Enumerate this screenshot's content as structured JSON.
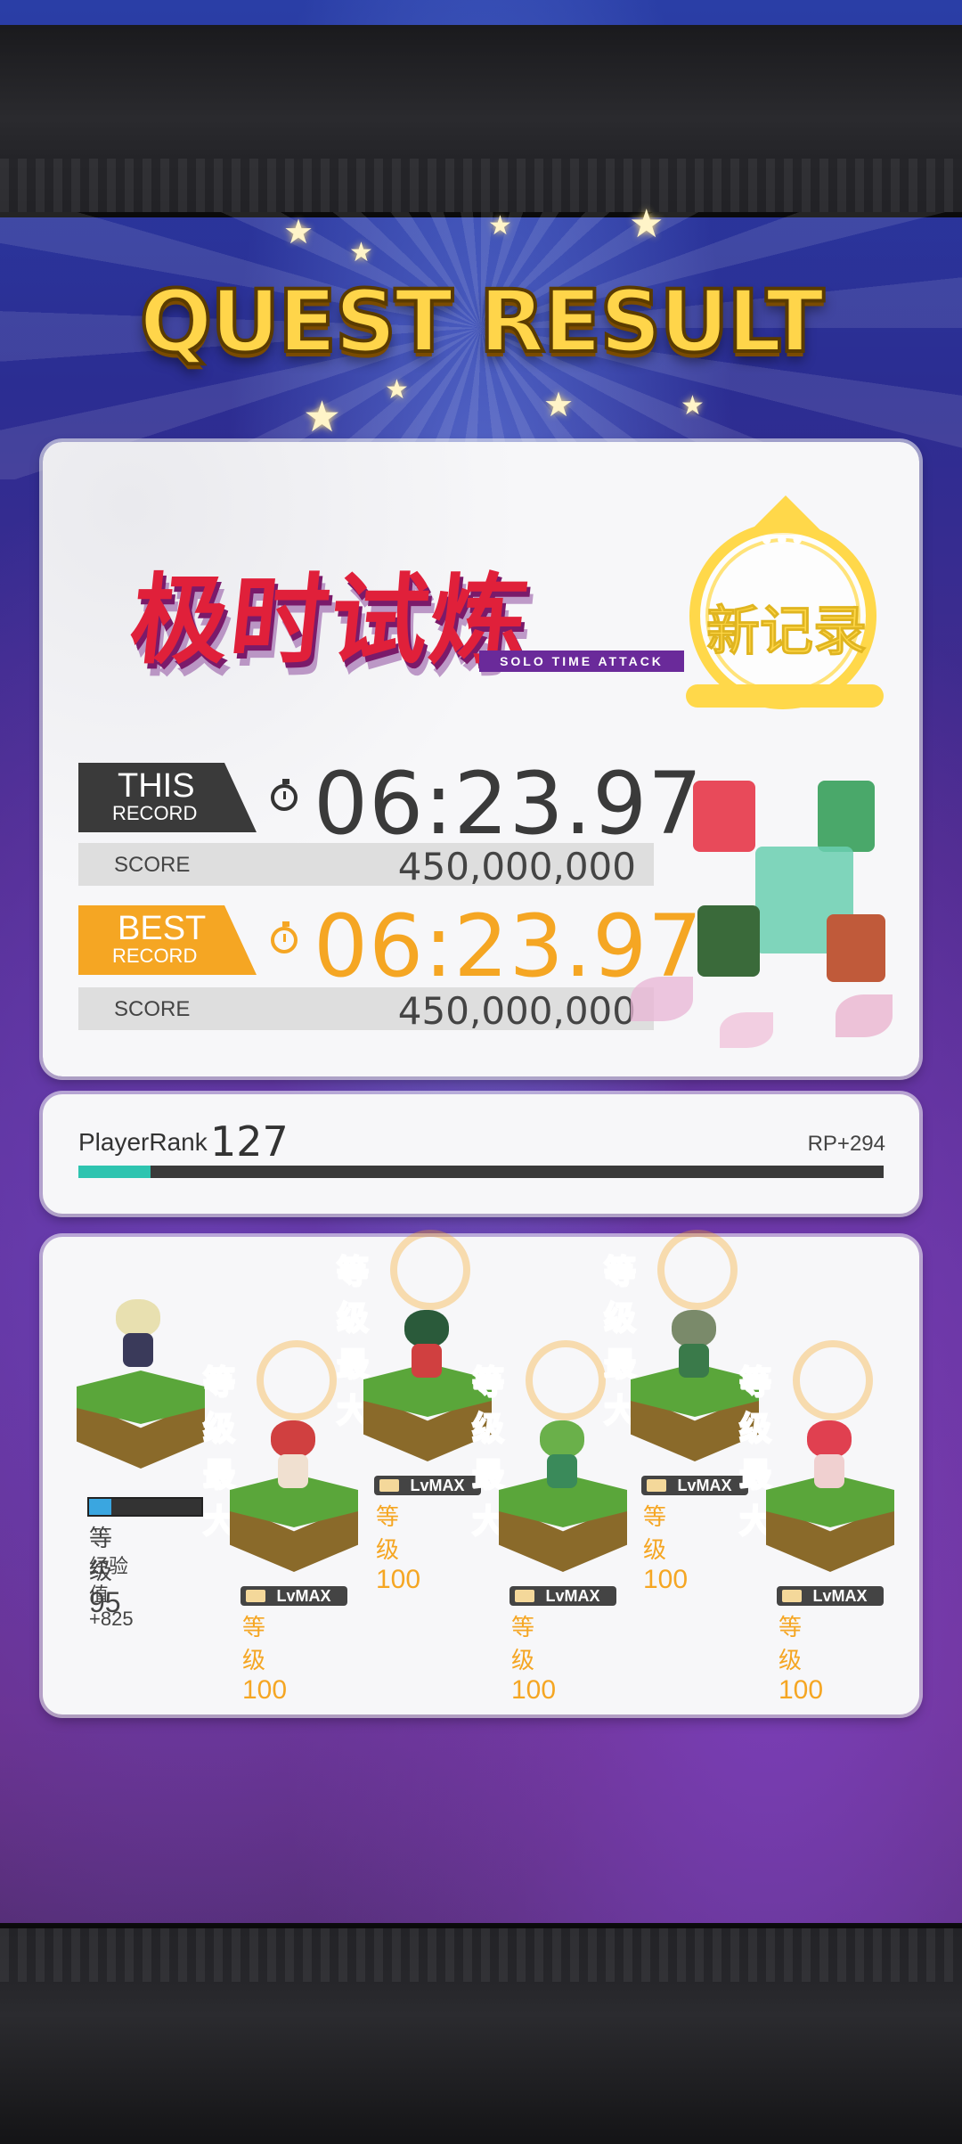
{
  "title": "QUEST RESULT",
  "event_logo": {
    "cn": "极时试炼",
    "en": "SOLO TIME ATTACK"
  },
  "new_record_badge": "新记录",
  "this_record": {
    "tag_main": "THIS",
    "tag_sub": "RECORD",
    "time": "06:23.97",
    "score_label": "SCORE",
    "score": "450,000,000"
  },
  "best_record": {
    "tag_main": "BEST",
    "tag_sub": "RECORD",
    "time": "06:23.97",
    "score_label": "SCORE",
    "score": "450,000,000"
  },
  "player_rank": {
    "label": "PlayerRank",
    "value": "127",
    "rp": "RP+294",
    "progress": 0.09
  },
  "units": {
    "leader": {
      "level_label": "等级",
      "level": "95",
      "exp": "经验值+825",
      "xp_progress": 0.2
    },
    "max_label": "等级最大!",
    "lvmax_badge": "LvMAX",
    "level_label": "等级",
    "level_value": "100"
  },
  "colors": {
    "accent": "#f5a623",
    "dark": "#3a3a3a",
    "rank_fill": "#2ec4b0",
    "title_gold": "#ffd54a"
  }
}
